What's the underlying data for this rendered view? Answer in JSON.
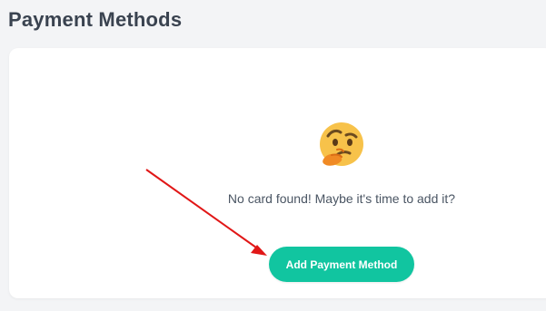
{
  "page": {
    "title": "Payment Methods"
  },
  "empty_state": {
    "icon": "thinking-face-icon",
    "message": "No card found! Maybe it's time to add it?",
    "button_label": "Add Payment Method"
  },
  "colors": {
    "button": "#11c5a0",
    "arrow": "#e11717",
    "title": "#3a4350"
  }
}
